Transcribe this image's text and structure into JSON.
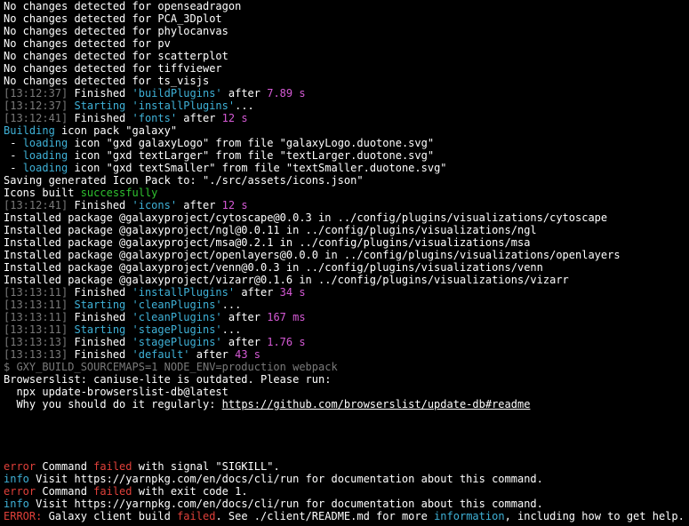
{
  "terminal": {
    "colors": {
      "background": "#000000",
      "text": "#ffffff",
      "timestamp": "#7a7a7a",
      "task_name": "#3fb2d8",
      "duration": "#d65ad6",
      "success": "#2fc32f",
      "error": "#e0403a"
    },
    "lines": [
      [
        {
          "t": "No changes detected for openseadragon",
          "c": "white"
        }
      ],
      [
        {
          "t": "No changes detected for PCA_3Dplot",
          "c": "white"
        }
      ],
      [
        {
          "t": "No changes detected for phylocanvas",
          "c": "white"
        }
      ],
      [
        {
          "t": "No changes detected for pv",
          "c": "white"
        }
      ],
      [
        {
          "t": "No changes detected for scatterplot",
          "c": "white"
        }
      ],
      [
        {
          "t": "No changes detected for tiffviewer",
          "c": "white"
        }
      ],
      [
        {
          "t": "No changes detected for ts_visjs",
          "c": "white"
        }
      ],
      [
        {
          "t": "[13:12:37]",
          "c": "gray"
        },
        {
          "t": " Finished ",
          "c": "white"
        },
        {
          "t": "'buildPlugins'",
          "c": "cyan"
        },
        {
          "t": " after ",
          "c": "white"
        },
        {
          "t": "7.89 s",
          "c": "magenta"
        }
      ],
      [
        {
          "t": "[13:12:37]",
          "c": "gray"
        },
        {
          "t": " Starting ",
          "c": "cyan"
        },
        {
          "t": "'installPlugins'",
          "c": "cyan"
        },
        {
          "t": "...",
          "c": "white"
        }
      ],
      [
        {
          "t": "[13:12:41]",
          "c": "gray"
        },
        {
          "t": " Finished ",
          "c": "white"
        },
        {
          "t": "'fonts'",
          "c": "cyan"
        },
        {
          "t": " after ",
          "c": "white"
        },
        {
          "t": "12 s",
          "c": "magenta"
        }
      ],
      [
        {
          "t": "Building",
          "c": "cyan"
        },
        {
          "t": " icon pack \"galaxy\"",
          "c": "white"
        }
      ],
      [
        {
          "t": " - ",
          "c": "white"
        },
        {
          "t": "loading",
          "c": "cyan"
        },
        {
          "t": " icon \"gxd galaxyLogo\" from file \"galaxyLogo.duotone.svg\"",
          "c": "white"
        }
      ],
      [
        {
          "t": " - ",
          "c": "white"
        },
        {
          "t": "loading",
          "c": "cyan"
        },
        {
          "t": " icon \"gxd textLarger\" from file \"textLarger.duotone.svg\"",
          "c": "white"
        }
      ],
      [
        {
          "t": " - ",
          "c": "white"
        },
        {
          "t": "loading",
          "c": "cyan"
        },
        {
          "t": " icon \"gxd textSmaller\" from file \"textSmaller.duotone.svg\"",
          "c": "white"
        }
      ],
      [
        {
          "t": "Saving generated Icon Pack to: \"./src/assets/icons.json\"",
          "c": "white"
        }
      ],
      [
        {
          "t": "Icons built ",
          "c": "white"
        },
        {
          "t": "successfully",
          "c": "green"
        }
      ],
      [
        {
          "t": "[13:12:41]",
          "c": "gray"
        },
        {
          "t": " Finished ",
          "c": "white"
        },
        {
          "t": "'icons'",
          "c": "cyan"
        },
        {
          "t": " after ",
          "c": "white"
        },
        {
          "t": "12 s",
          "c": "magenta"
        }
      ],
      [
        {
          "t": "Installed package @galaxyproject/cytoscape@0.0.3 in ../config/plugins/visualizations/cytoscape",
          "c": "white"
        }
      ],
      [
        {
          "t": "Installed package @galaxyproject/ngl@0.0.11 in ../config/plugins/visualizations/ngl",
          "c": "white"
        }
      ],
      [
        {
          "t": "Installed package @galaxyproject/msa@0.2.1 in ../config/plugins/visualizations/msa",
          "c": "white"
        }
      ],
      [
        {
          "t": "Installed package @galaxyproject/openlayers@0.0.0 in ../config/plugins/visualizations/openlayers",
          "c": "white"
        }
      ],
      [
        {
          "t": "Installed package @galaxyproject/venn@0.0.3 in ../config/plugins/visualizations/venn",
          "c": "white"
        }
      ],
      [
        {
          "t": "Installed package @galaxyproject/vizarr@0.1.6 in ../config/plugins/visualizations/vizarr",
          "c": "white"
        }
      ],
      [
        {
          "t": "[13:13:11]",
          "c": "gray"
        },
        {
          "t": " Finished ",
          "c": "white"
        },
        {
          "t": "'installPlugins'",
          "c": "cyan"
        },
        {
          "t": " after ",
          "c": "white"
        },
        {
          "t": "34 s",
          "c": "magenta"
        }
      ],
      [
        {
          "t": "[13:13:11]",
          "c": "gray"
        },
        {
          "t": " Starting ",
          "c": "cyan"
        },
        {
          "t": "'cleanPlugins'",
          "c": "cyan"
        },
        {
          "t": "...",
          "c": "white"
        }
      ],
      [
        {
          "t": "[13:13:11]",
          "c": "gray"
        },
        {
          "t": " Finished ",
          "c": "white"
        },
        {
          "t": "'cleanPlugins'",
          "c": "cyan"
        },
        {
          "t": " after ",
          "c": "white"
        },
        {
          "t": "167 ms",
          "c": "magenta"
        }
      ],
      [
        {
          "t": "[13:13:11]",
          "c": "gray"
        },
        {
          "t": " Starting ",
          "c": "cyan"
        },
        {
          "t": "'stagePlugins'",
          "c": "cyan"
        },
        {
          "t": "...",
          "c": "white"
        }
      ],
      [
        {
          "t": "[13:13:13]",
          "c": "gray"
        },
        {
          "t": " Finished ",
          "c": "white"
        },
        {
          "t": "'stagePlugins'",
          "c": "cyan"
        },
        {
          "t": " after ",
          "c": "white"
        },
        {
          "t": "1.76 s",
          "c": "magenta"
        }
      ],
      [
        {
          "t": "[13:13:13]",
          "c": "gray"
        },
        {
          "t": " Finished ",
          "c": "white"
        },
        {
          "t": "'default'",
          "c": "cyan"
        },
        {
          "t": " after ",
          "c": "white"
        },
        {
          "t": "43 s",
          "c": "magenta"
        }
      ],
      [
        {
          "t": "$ GXY_BUILD_SOURCEMAPS=1 NODE_ENV=production webpack",
          "c": "gray"
        }
      ],
      [
        {
          "t": "Browserslist: caniuse-lite is outdated. Please run:",
          "c": "white"
        }
      ],
      [
        {
          "t": "  npx update-browserslist-db@latest",
          "c": "white"
        }
      ],
      [
        {
          "t": "  Why you should do it regularly: ",
          "c": "white"
        },
        {
          "t": "https://github.com/browserslist/update-db#readme",
          "c": "link"
        }
      ],
      [],
      [],
      [],
      [],
      [
        {
          "t": "error",
          "c": "red"
        },
        {
          "t": " Command ",
          "c": "white"
        },
        {
          "t": "failed",
          "c": "red"
        },
        {
          "t": " with signal \"SIGKILL\".",
          "c": "white"
        }
      ],
      [
        {
          "t": "info",
          "c": "cyan"
        },
        {
          "t": " Visit https://yarnpkg.com/en/docs/cli/run for documentation about this command.",
          "c": "white"
        }
      ],
      [
        {
          "t": "error",
          "c": "red"
        },
        {
          "t": " Command ",
          "c": "white"
        },
        {
          "t": "failed",
          "c": "red"
        },
        {
          "t": " with exit code 1.",
          "c": "white"
        }
      ],
      [
        {
          "t": "info",
          "c": "cyan"
        },
        {
          "t": " Visit https://yarnpkg.com/en/docs/cli/run for documentation about this command.",
          "c": "white"
        }
      ],
      [
        {
          "t": "ERROR:",
          "c": "red"
        },
        {
          "t": " Galaxy client build ",
          "c": "white"
        },
        {
          "t": "failed",
          "c": "red"
        },
        {
          "t": ". See ./client/README.md for more ",
          "c": "white"
        },
        {
          "t": "information",
          "c": "cyan"
        },
        {
          "t": ", including how to get help.",
          "c": "white"
        }
      ]
    ]
  }
}
